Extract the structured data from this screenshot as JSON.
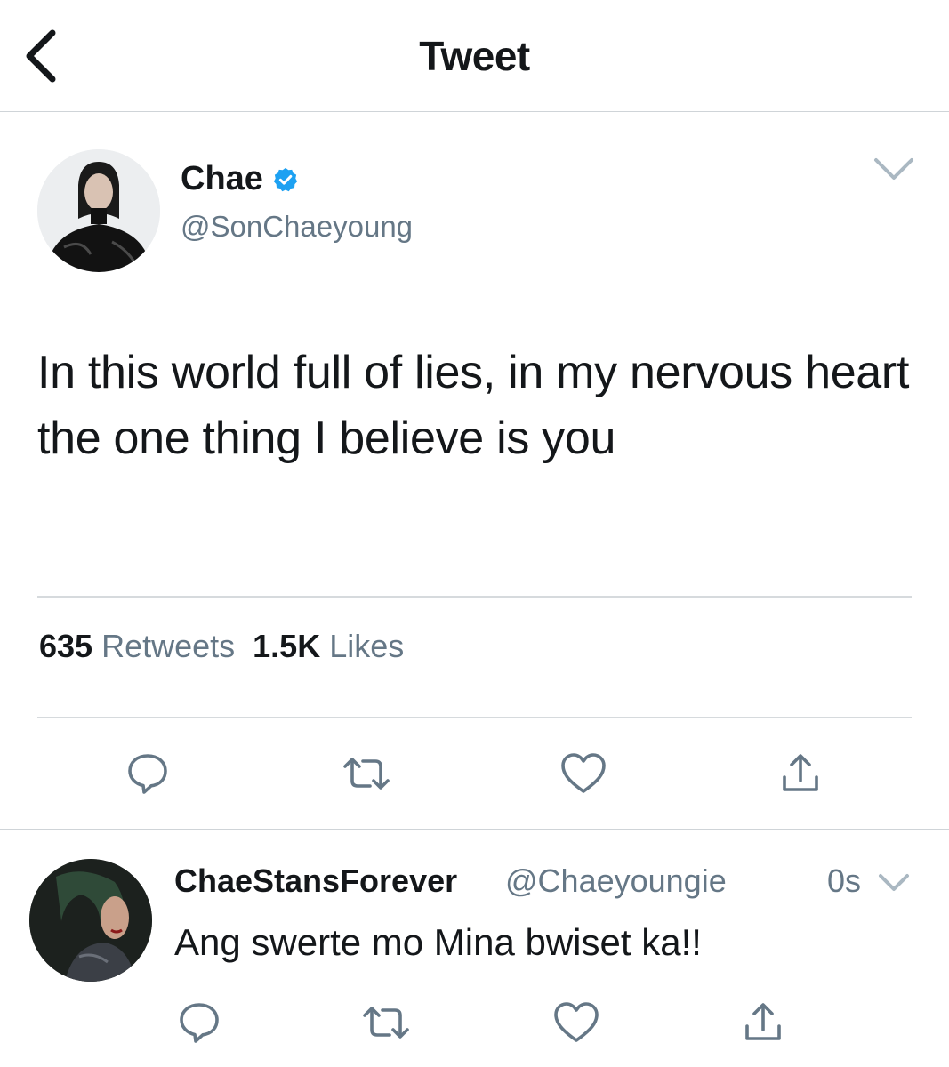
{
  "header": {
    "title": "Tweet"
  },
  "tweet": {
    "display_name": "Chae",
    "verified": true,
    "handle": "@SonChaeyoung",
    "text": "In this world full of lies, in my nervous heart the one thing I believe is you",
    "retweets_count": "635",
    "retweets_label": "Retweets",
    "likes_count": "1.5K",
    "likes_label": "Likes"
  },
  "reply": {
    "display_name": "ChaeStansForever",
    "handle": "@Chaeyoungie",
    "time": "0s",
    "text": "Ang swerte mo Mina bwiset ka!!"
  },
  "icons": {
    "back": "chevron-left-icon",
    "more": "chevron-down-icon",
    "verified": "verified-badge-icon",
    "reply": "reply-bubble-icon",
    "retweet": "retweet-icon",
    "like": "heart-icon",
    "share": "share-icon"
  },
  "colors": {
    "accent": "#1da1f2",
    "icon_gray": "#657786",
    "text": "#14171a",
    "divider": "#d6dadd"
  }
}
